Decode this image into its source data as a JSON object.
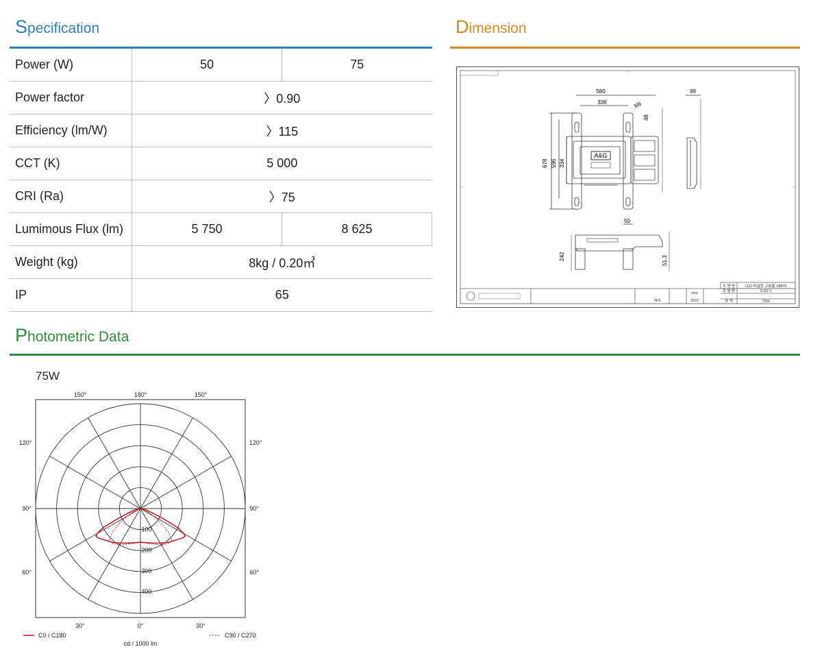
{
  "specification": {
    "title_cap": "S",
    "title_rest": "pecification",
    "color": "#2a7fc1",
    "rows": [
      {
        "label": "Power (W)",
        "values": [
          "50",
          "75"
        ]
      },
      {
        "label": "Power factor",
        "values": [
          "〉0.90"
        ]
      },
      {
        "label": "Efficiency (lm/W)",
        "values": [
          "〉115"
        ]
      },
      {
        "label": "CCT (K)",
        "values": [
          "5 000"
        ]
      },
      {
        "label": "CRI (Ra)",
        "values": [
          "〉75"
        ]
      },
      {
        "label": "Lumimous Flux (lm)",
        "values": [
          "5 750",
          "8 625"
        ]
      },
      {
        "label": "Weight (kg)",
        "values": [
          "8kg / 0.20㎥"
        ]
      },
      {
        "label": "IP",
        "values": [
          "65"
        ]
      }
    ]
  },
  "dimension": {
    "title_cap": "D",
    "title_rest": "imension",
    "color": "#d9891e",
    "dims": {
      "width_total": "580",
      "width_inner": "336",
      "radius": "R6",
      "tab": "48",
      "depth": "99",
      "height_total": "678",
      "height_mid": "596",
      "height_body": "334",
      "slot": "50",
      "side_h": "242",
      "side_s": "51.3"
    },
    "brand_label": "A&G",
    "title_block": {
      "r1a": "도 면 명",
      "r1b": "LED 터널등 고효율 SMPS",
      "r2a": "모 델 명",
      "r2b": "G-82-1",
      "r3a": "규 격",
      "r3b": "75W",
      "ns": "N/S",
      "year": "2022",
      "unit": "mm"
    }
  },
  "photometric": {
    "title_cap": "P",
    "title_rest": "hotometric Data",
    "color": "#2e8b3a"
  },
  "chart_data": {
    "type": "polar",
    "title": "75W",
    "angle_labels": {
      "top": [
        "150°",
        "180°",
        "150°"
      ],
      "upper_side": "120°",
      "mid_side": "90°",
      "lower_side": "60°",
      "bottom": [
        "30°",
        "0°",
        "30°"
      ]
    },
    "radial_ticks": [
      "100",
      "200",
      "300",
      "400"
    ],
    "rmax": 500,
    "unit": "cd / 1000 lm",
    "series": [
      {
        "name": "C0 / C180",
        "color": "#c0121a",
        "style": "solid",
        "points": [
          [
            0,
            160
          ],
          [
            10,
            165
          ],
          [
            20,
            175
          ],
          [
            30,
            190
          ],
          [
            40,
            210
          ],
          [
            50,
            230
          ],
          [
            55,
            245
          ],
          [
            58,
            250
          ],
          [
            60,
            240
          ],
          [
            63,
            200
          ],
          [
            66,
            120
          ],
          [
            70,
            60
          ],
          [
            75,
            30
          ],
          [
            80,
            15
          ],
          [
            90,
            5
          ]
        ]
      },
      {
        "name": "C90 / C270",
        "color": "#c0121a",
        "style": "dotted",
        "points": [
          [
            0,
            160
          ],
          [
            10,
            168
          ],
          [
            20,
            180
          ],
          [
            30,
            200
          ],
          [
            40,
            215
          ],
          [
            45,
            210
          ],
          [
            50,
            175
          ],
          [
            55,
            120
          ],
          [
            60,
            70
          ],
          [
            65,
            40
          ],
          [
            70,
            22
          ],
          [
            80,
            10
          ],
          [
            90,
            4
          ]
        ]
      }
    ]
  }
}
